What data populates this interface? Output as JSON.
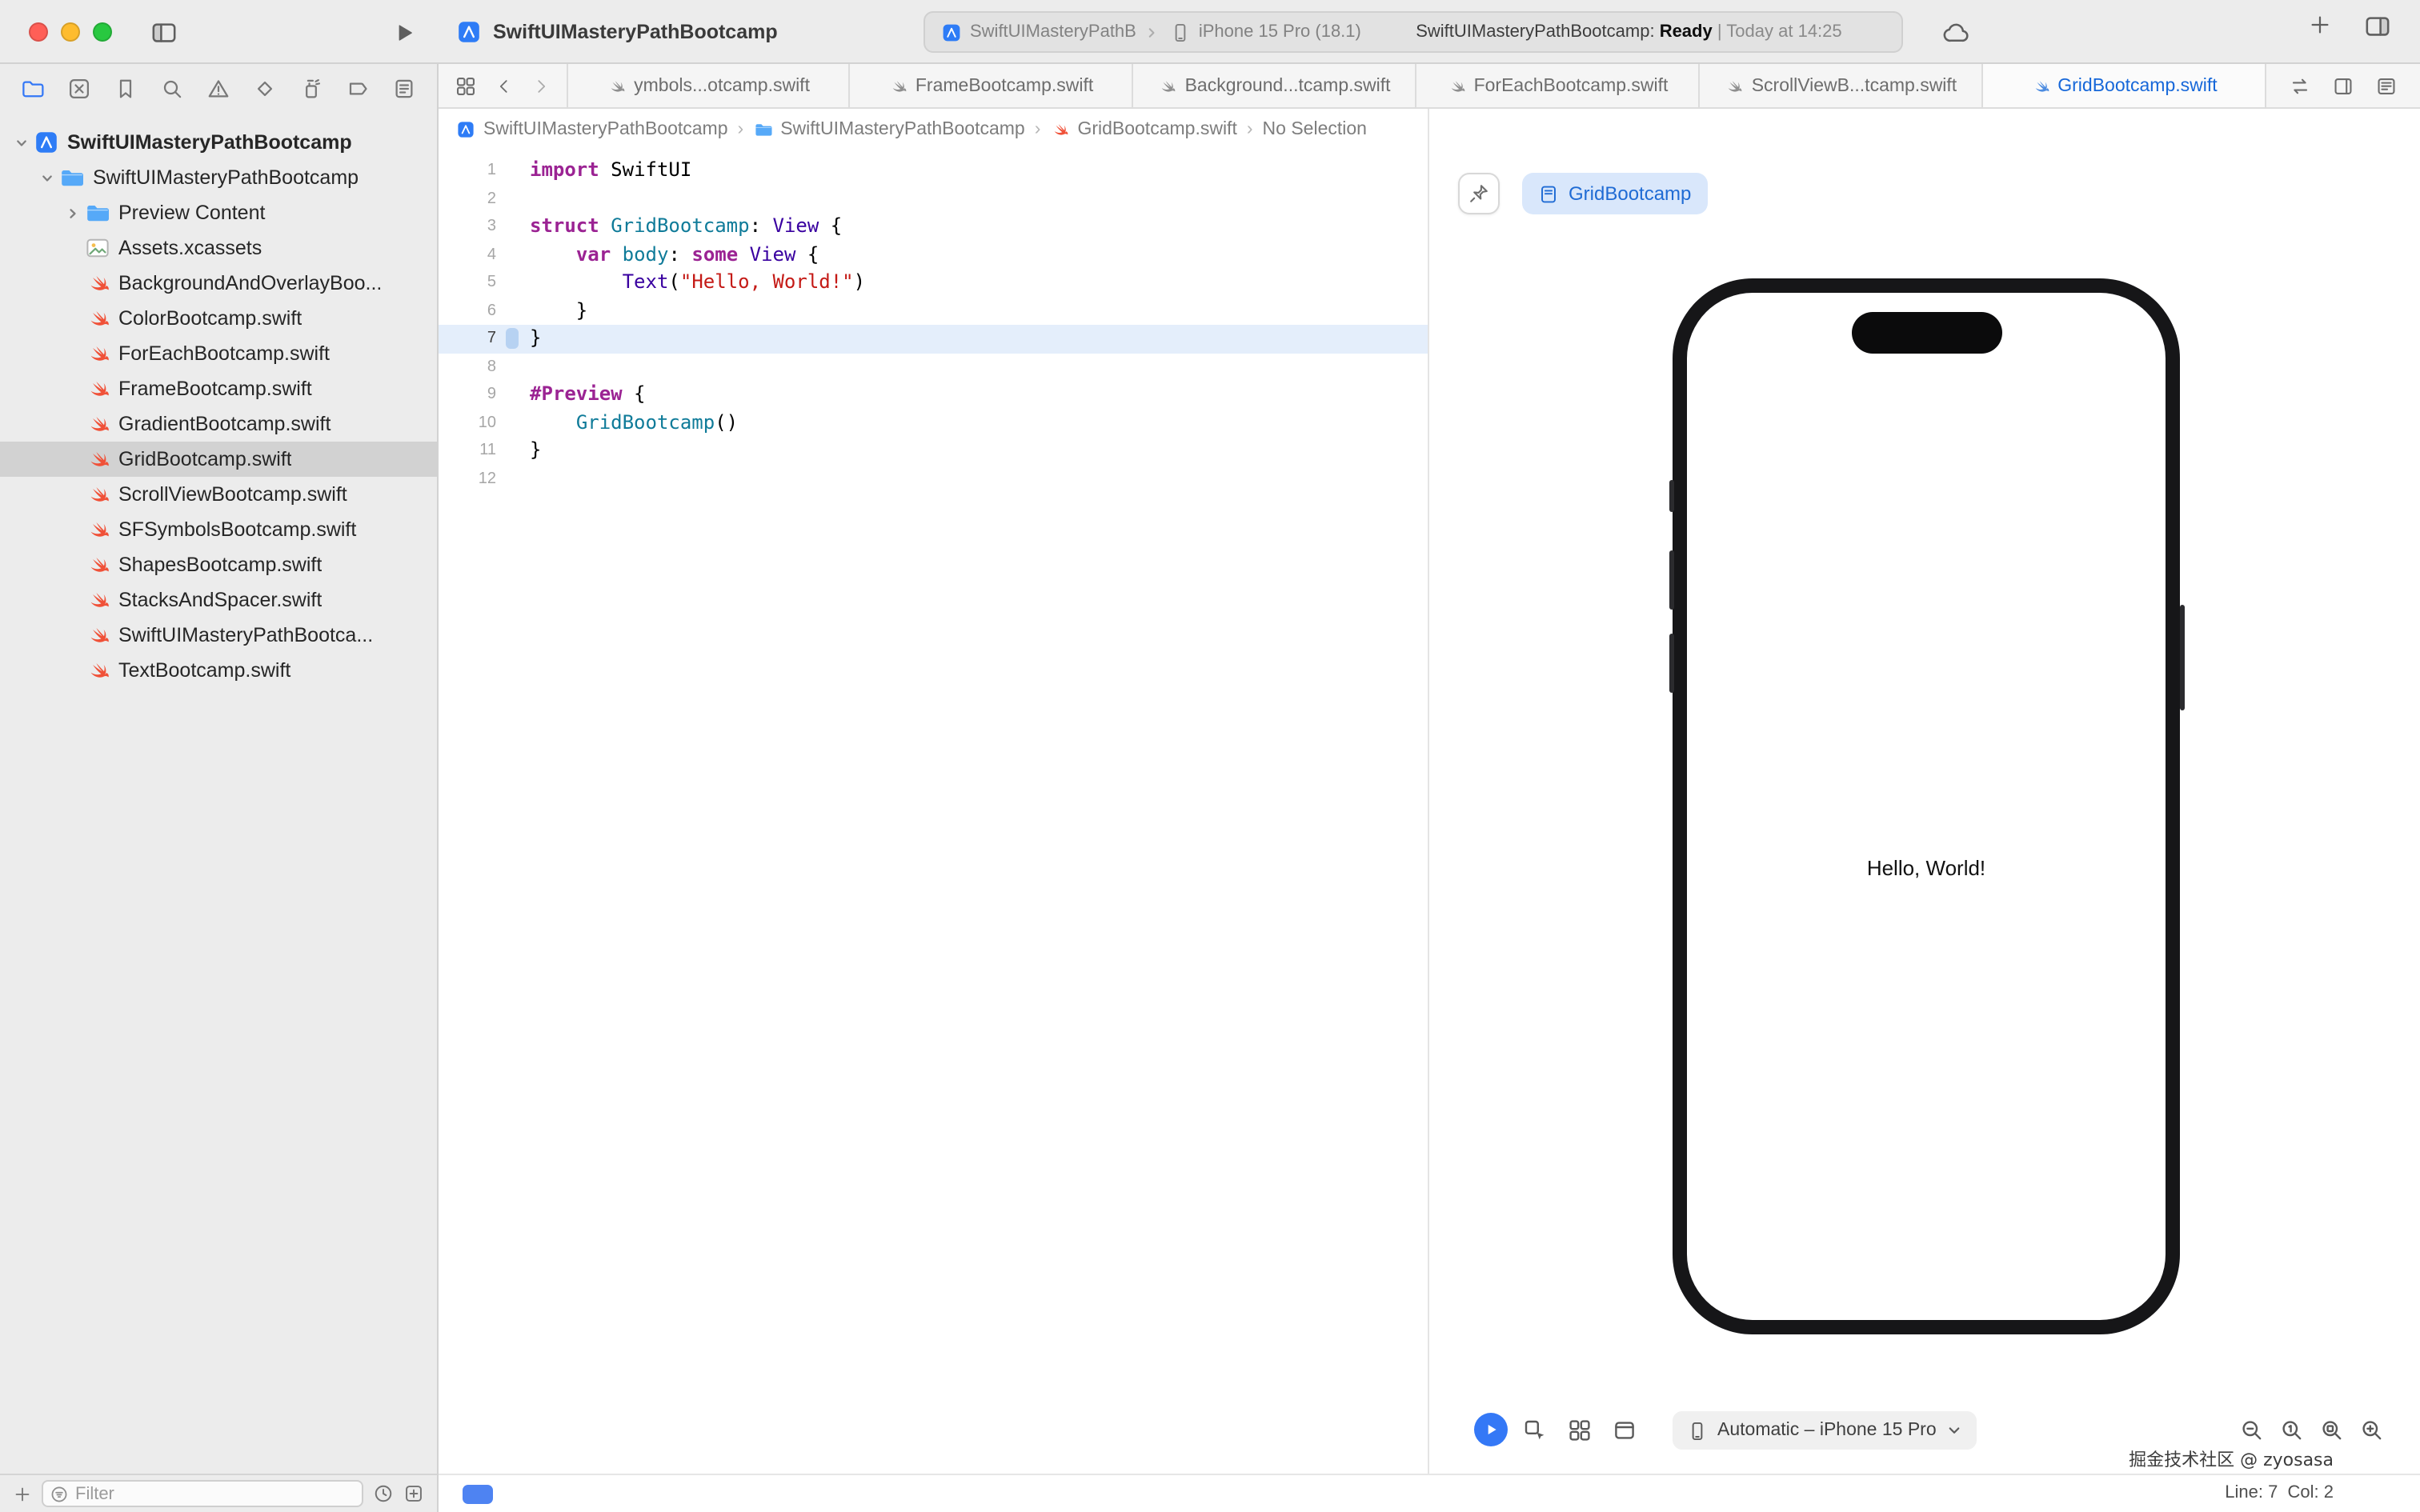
{
  "titlebar": {
    "title": "SwiftUIMasteryPathBootcamp",
    "scheme": "SwiftUIMasteryPathB",
    "destination": "iPhone 15 Pro (18.1)",
    "status_prefix": "SwiftUIMasteryPathBootcamp:",
    "status_state": "Ready",
    "status_suffix": "| Today at 14:25"
  },
  "sidebar": {
    "nav_items": [
      {
        "name": "project-navigator",
        "active": true
      },
      {
        "name": "source-control",
        "active": false
      },
      {
        "name": "bookmarks",
        "active": false
      },
      {
        "name": "find",
        "active": false
      },
      {
        "name": "issues",
        "active": false
      },
      {
        "name": "tests",
        "active": false
      },
      {
        "name": "debug",
        "active": false
      },
      {
        "name": "breakpoints",
        "active": false
      },
      {
        "name": "reports",
        "active": false
      }
    ],
    "tree": [
      {
        "label": "SwiftUIMasteryPathBootcamp",
        "icon": "project-file",
        "level": 0,
        "disclosure": "down",
        "bold": true
      },
      {
        "label": "SwiftUIMasteryPathBootcamp",
        "icon": "folder",
        "level": 1,
        "disclosure": "down"
      },
      {
        "label": "Preview Content",
        "icon": "folder",
        "level": 2,
        "disclosure": "right"
      },
      {
        "label": "Assets.xcassets",
        "icon": "assets",
        "level": 2
      },
      {
        "label": "BackgroundAndOverlayBoo...",
        "icon": "swift-file",
        "level": 2
      },
      {
        "label": "ColorBootcamp.swift",
        "icon": "swift-file",
        "level": 2
      },
      {
        "label": "ForEachBootcamp.swift",
        "icon": "swift-file",
        "level": 2
      },
      {
        "label": "FrameBootcamp.swift",
        "icon": "swift-file",
        "level": 2
      },
      {
        "label": "GradientBootcamp.swift",
        "icon": "swift-file",
        "level": 2
      },
      {
        "label": "GridBootcamp.swift",
        "icon": "swift-file",
        "level": 2,
        "selected": true
      },
      {
        "label": "ScrollViewBootcamp.swift",
        "icon": "swift-file",
        "level": 2
      },
      {
        "label": "SFSymbolsBootcamp.swift",
        "icon": "swift-file",
        "level": 2
      },
      {
        "label": "ShapesBootcamp.swift",
        "icon": "swift-file",
        "level": 2
      },
      {
        "label": "StacksAndSpacer.swift",
        "icon": "swift-file",
        "level": 2
      },
      {
        "label": "SwiftUIMasteryPathBootca...",
        "icon": "swift-file",
        "level": 2
      },
      {
        "label": "TextBootcamp.swift",
        "icon": "swift-file",
        "level": 2
      }
    ],
    "filter_placeholder": "Filter"
  },
  "editor": {
    "tabs": [
      {
        "label": "ymbols...otcamp.swift",
        "active": false
      },
      {
        "label": "FrameBootcamp.swift",
        "active": false
      },
      {
        "label": "Background...tcamp.swift",
        "active": false
      },
      {
        "label": "ForEachBootcamp.swift",
        "active": false
      },
      {
        "label": "ScrollViewB...tcamp.swift",
        "active": false
      },
      {
        "label": "GridBootcamp.swift",
        "active": true
      }
    ],
    "breadcrumb": [
      {
        "icon": "project-file",
        "label": "SwiftUIMasteryPathBootcamp"
      },
      {
        "icon": "folder",
        "label": "SwiftUIMasteryPathBootcamp"
      },
      {
        "icon": "swift-file",
        "label": "GridBootcamp.swift"
      },
      {
        "icon": null,
        "label": "No Selection"
      }
    ],
    "breadcrumb_separator": "›",
    "code_lines": [
      {
        "n": 1,
        "tokens": [
          [
            "kw",
            "import"
          ],
          [
            "pl",
            " SwiftUI"
          ]
        ]
      },
      {
        "n": 2,
        "tokens": []
      },
      {
        "n": 3,
        "tokens": [
          [
            "kw",
            "struct"
          ],
          [
            "pl",
            " "
          ],
          [
            "decl",
            "GridBootcamp"
          ],
          [
            "pl",
            ": "
          ],
          [
            "type",
            "View"
          ],
          [
            "pl",
            " {"
          ]
        ]
      },
      {
        "n": 4,
        "tokens": [
          [
            "pl",
            "    "
          ],
          [
            "kw",
            "var"
          ],
          [
            "pl",
            " "
          ],
          [
            "decl",
            "body"
          ],
          [
            "pl",
            ": "
          ],
          [
            "kw",
            "some"
          ],
          [
            "pl",
            " "
          ],
          [
            "type",
            "View"
          ],
          [
            "pl",
            " {"
          ]
        ]
      },
      {
        "n": 5,
        "tokens": [
          [
            "pl",
            "        "
          ],
          [
            "type",
            "Text"
          ],
          [
            "pl",
            "("
          ],
          [
            "str",
            "\"Hello, World!\""
          ],
          [
            "pl",
            ")"
          ]
        ]
      },
      {
        "n": 6,
        "tokens": [
          [
            "pl",
            "    }"
          ]
        ]
      },
      {
        "n": 7,
        "tokens": [
          [
            "pl",
            "}"
          ]
        ],
        "current": true
      },
      {
        "n": 8,
        "tokens": []
      },
      {
        "n": 9,
        "tokens": [
          [
            "kw",
            "#Preview"
          ],
          [
            "pl",
            " {"
          ]
        ]
      },
      {
        "n": 10,
        "tokens": [
          [
            "pl",
            "    "
          ],
          [
            "decl",
            "GridBootcamp"
          ],
          [
            "pl",
            "()"
          ]
        ]
      },
      {
        "n": 11,
        "tokens": [
          [
            "pl",
            "}"
          ]
        ]
      },
      {
        "n": 12,
        "tokens": []
      }
    ]
  },
  "canvas": {
    "preview_chip": "GridBootcamp",
    "device_text": "Hello, World!",
    "device_selector": "Automatic – iPhone 15 Pro"
  },
  "statusbar": {
    "line_col": "Line: 7  Col: 2",
    "watermark": "掘金技术社区 @ zyosasa"
  }
}
